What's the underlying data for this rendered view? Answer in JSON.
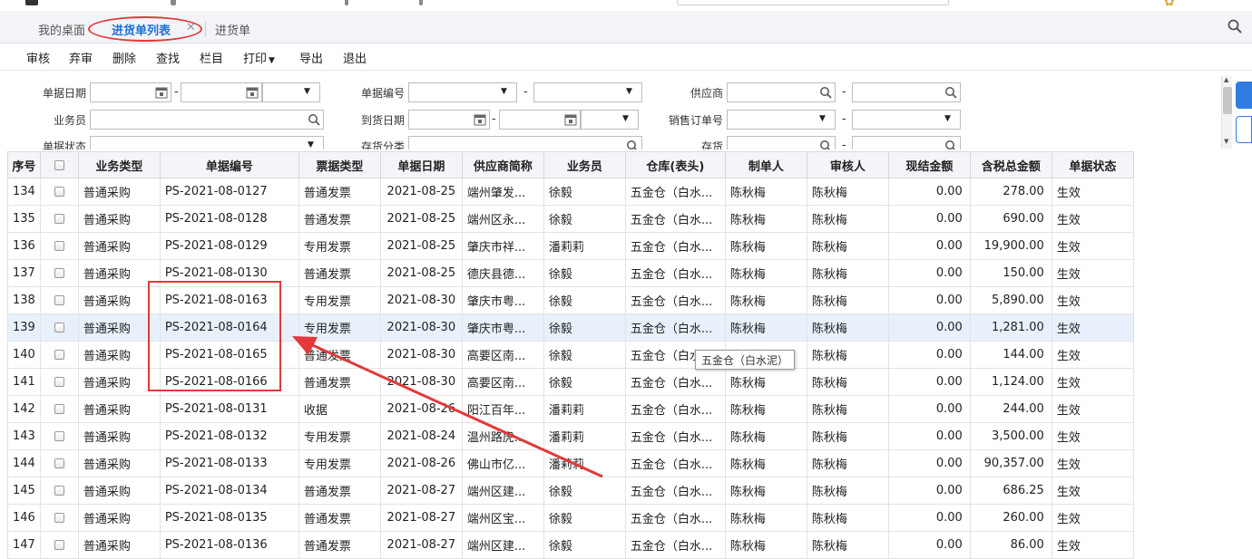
{
  "tabs": [
    {
      "label": "我的桌面",
      "active": false
    },
    {
      "label": "进货单列表",
      "active": true
    },
    {
      "label": "进货单",
      "active": false
    }
  ],
  "toolbar": [
    "审核",
    "弃审",
    "删除",
    "查找",
    "栏目",
    "打印",
    "导出",
    "退出"
  ],
  "filters": {
    "date_label": "单据日期",
    "docno_label": "单据编号",
    "supplier_label": "供应商",
    "staff_label": "业务员",
    "arrive_label": "到货日期",
    "sales_order_label": "销售订单号",
    "status_label": "单据状态",
    "category_label": "存货分类",
    "stock_label": "存货"
  },
  "columns": [
    "序号",
    "",
    "业务类型",
    "单据编号",
    "票据类型",
    "单据日期",
    "供应商简称",
    "业务员",
    "仓库(表头)",
    "制单人",
    "审核人",
    "现结金额",
    "含税总金额",
    "单据状态"
  ],
  "rows": [
    [
      "134",
      "普通采购",
      "PS-2021-08-0127",
      "普通发票",
      "2021-08-25",
      "端州肇发...",
      "徐毅",
      "五金仓（白水...",
      "陈秋梅",
      "陈秋梅",
      "0.00",
      "278.00",
      "生效"
    ],
    [
      "135",
      "普通采购",
      "PS-2021-08-0128",
      "普通发票",
      "2021-08-25",
      "端州区永...",
      "徐毅",
      "五金仓（白水...",
      "陈秋梅",
      "陈秋梅",
      "0.00",
      "690.00",
      "生效"
    ],
    [
      "136",
      "普通采购",
      "PS-2021-08-0129",
      "专用发票",
      "2021-08-25",
      "肇庆市祥...",
      "潘莉莉",
      "五金仓（白水...",
      "陈秋梅",
      "陈秋梅",
      "0.00",
      "19,900.00",
      "生效"
    ],
    [
      "137",
      "普通采购",
      "PS-2021-08-0130",
      "普通发票",
      "2021-08-25",
      "德庆县德...",
      "徐毅",
      "五金仓（白水...",
      "陈秋梅",
      "陈秋梅",
      "0.00",
      "150.00",
      "生效"
    ],
    [
      "138",
      "普通采购",
      "PS-2021-08-0163",
      "专用发票",
      "2021-08-30",
      "肇庆市粤...",
      "徐毅",
      "五金仓（白水...",
      "陈秋梅",
      "陈秋梅",
      "0.00",
      "5,890.00",
      "生效"
    ],
    [
      "139",
      "普通采购",
      "PS-2021-08-0164",
      "专用发票",
      "2021-08-30",
      "肇庆市粤...",
      "徐毅",
      "五金仓（白水...",
      "陈秋梅",
      "陈秋梅",
      "0.00",
      "1,281.00",
      "生效"
    ],
    [
      "140",
      "普通采购",
      "PS-2021-08-0165",
      "普通发票",
      "2021-08-30",
      "高要区南...",
      "徐毅",
      "五金仓（白水...",
      "陈秋梅",
      "陈秋梅",
      "0.00",
      "144.00",
      "生效"
    ],
    [
      "141",
      "普通采购",
      "PS-2021-08-0166",
      "普通发票",
      "2021-08-30",
      "高要区南...",
      "徐毅",
      "五金仓（白水...",
      "陈秋梅",
      "陈秋梅",
      "0.00",
      "1,124.00",
      "生效"
    ],
    [
      "142",
      "普通采购",
      "PS-2021-08-0131",
      "收据",
      "2021-08-26",
      "阳江百年...",
      "潘莉莉",
      "五金仓（白水...",
      "陈秋梅",
      "陈秋梅",
      "0.00",
      "244.00",
      "生效"
    ],
    [
      "143",
      "普通采购",
      "PS-2021-08-0132",
      "专用发票",
      "2021-08-24",
      "温州路虎...",
      "潘莉莉",
      "五金仓（白水...",
      "陈秋梅",
      "陈秋梅",
      "0.00",
      "3,500.00",
      "生效"
    ],
    [
      "144",
      "普通采购",
      "PS-2021-08-0133",
      "专用发票",
      "2021-08-26",
      "佛山市亿...",
      "潘莉莉",
      "五金仓（白水...",
      "陈秋梅",
      "陈秋梅",
      "0.00",
      "90,357.00",
      "生效"
    ],
    [
      "145",
      "普通采购",
      "PS-2021-08-0134",
      "普通发票",
      "2021-08-27",
      "端州区建...",
      "徐毅",
      "五金仓（白水...",
      "陈秋梅",
      "陈秋梅",
      "0.00",
      "686.25",
      "生效"
    ],
    [
      "146",
      "普通采购",
      "PS-2021-08-0135",
      "普通发票",
      "2021-08-27",
      "端州区宝...",
      "徐毅",
      "五金仓（白水...",
      "陈秋梅",
      "陈秋梅",
      "0.00",
      "260.00",
      "生效"
    ],
    [
      "147",
      "普通采购",
      "PS-2021-08-0136",
      "普通发票",
      "2021-08-27",
      "端州区建...",
      "徐毅",
      "五金仓（白水...",
      "陈秋梅",
      "陈秋梅",
      "0.00",
      "86.00",
      "生效"
    ]
  ],
  "selected_row": "139",
  "tooltip": "五金仓（白水泥）",
  "colors": {
    "accent": "#1e6fd9",
    "annotation": "#e23a3a",
    "selected_row": "#e8f1fb"
  }
}
